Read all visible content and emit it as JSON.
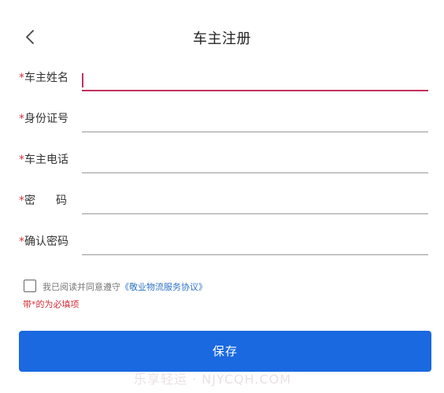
{
  "header": {
    "back_icon": "chevron-left-icon",
    "title": "车主注册"
  },
  "form": {
    "required_mark": "*",
    "fields": [
      {
        "label": "车主姓名",
        "value": "",
        "placeholder": ""
      },
      {
        "label": "身份证号",
        "value": "",
        "placeholder": ""
      },
      {
        "label": "车主电话",
        "value": "",
        "placeholder": ""
      },
      {
        "label_part1": "密",
        "label_part2": "码",
        "value": "",
        "placeholder": ""
      },
      {
        "label": "确认密码",
        "value": "",
        "placeholder": ""
      }
    ]
  },
  "agreement": {
    "checked": false,
    "text": "我已阅读并同意遵守",
    "link_text": "《敬业物流服务协议》"
  },
  "required_note": "带*的为必填项",
  "save_button": {
    "label": "保存"
  },
  "watermark": "乐享轻运 · NJYCQH.COM",
  "colors": {
    "accent": "#1a69e0",
    "required": "#d7323c",
    "active_underline": "#c3325e",
    "link": "#2f74c8"
  }
}
